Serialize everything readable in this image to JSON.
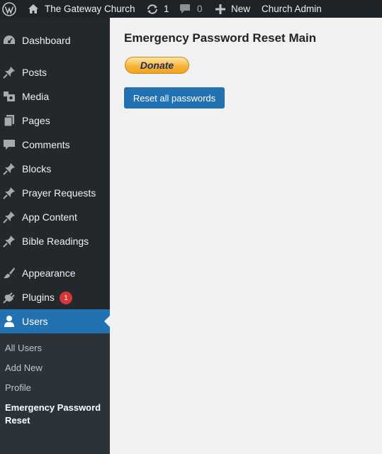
{
  "admin_bar": {
    "site_name": "The Gateway Church",
    "updates_count": "1",
    "comments_count": "0",
    "new_label": "New",
    "church_admin_label": "Church Admin"
  },
  "sidebar": {
    "items": [
      {
        "label": "Dashboard",
        "icon": "dashboard-icon"
      },
      {
        "label": "Posts",
        "icon": "pin-icon"
      },
      {
        "label": "Media",
        "icon": "media-icon"
      },
      {
        "label": "Pages",
        "icon": "pages-icon"
      },
      {
        "label": "Comments",
        "icon": "comment-icon"
      },
      {
        "label": "Blocks",
        "icon": "pin-icon"
      },
      {
        "label": "Prayer Requests",
        "icon": "pin-icon"
      },
      {
        "label": "App Content",
        "icon": "pin-icon"
      },
      {
        "label": "Bible Readings",
        "icon": "pin-icon"
      },
      {
        "label": "Appearance",
        "icon": "brush-icon"
      },
      {
        "label": "Plugins",
        "icon": "plugin-icon",
        "badge": "1"
      },
      {
        "label": "Users",
        "icon": "user-icon"
      }
    ],
    "submenu": [
      "All Users",
      "Add New",
      "Profile",
      "Emergency Password Reset"
    ]
  },
  "main": {
    "title": "Emergency Password Reset Main",
    "donate_label": "Donate",
    "reset_label": "Reset all passwords"
  },
  "colors": {
    "admin_bar_bg": "#1d2327",
    "sidebar_bg": "#23282d",
    "accent": "#2271b1",
    "badge": "#d63638"
  }
}
